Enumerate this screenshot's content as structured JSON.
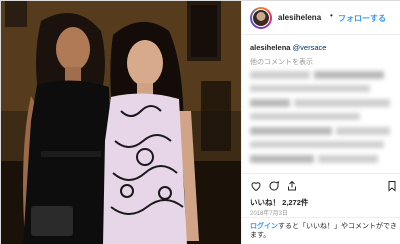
{
  "post": {
    "username": "alesihelena",
    "follow_label": "フォローする",
    "caption_user": "alesihelena",
    "caption_tag": "@versace",
    "more_comments_label": "他のコメントを表示",
    "likes_prefix": "いいね！",
    "likes_count": "2,272件",
    "date": "2018年7月3日"
  },
  "login_prompt": {
    "link": "ログイン",
    "text": "すると「いいね！」やコメントができます。"
  },
  "icons": {
    "like": "heart-icon",
    "comment": "comment-icon",
    "share": "share-icon",
    "save": "bookmark-icon"
  },
  "colors": {
    "link_blue": "#3897f0",
    "meta_gray": "#999999",
    "text": "#262626"
  }
}
